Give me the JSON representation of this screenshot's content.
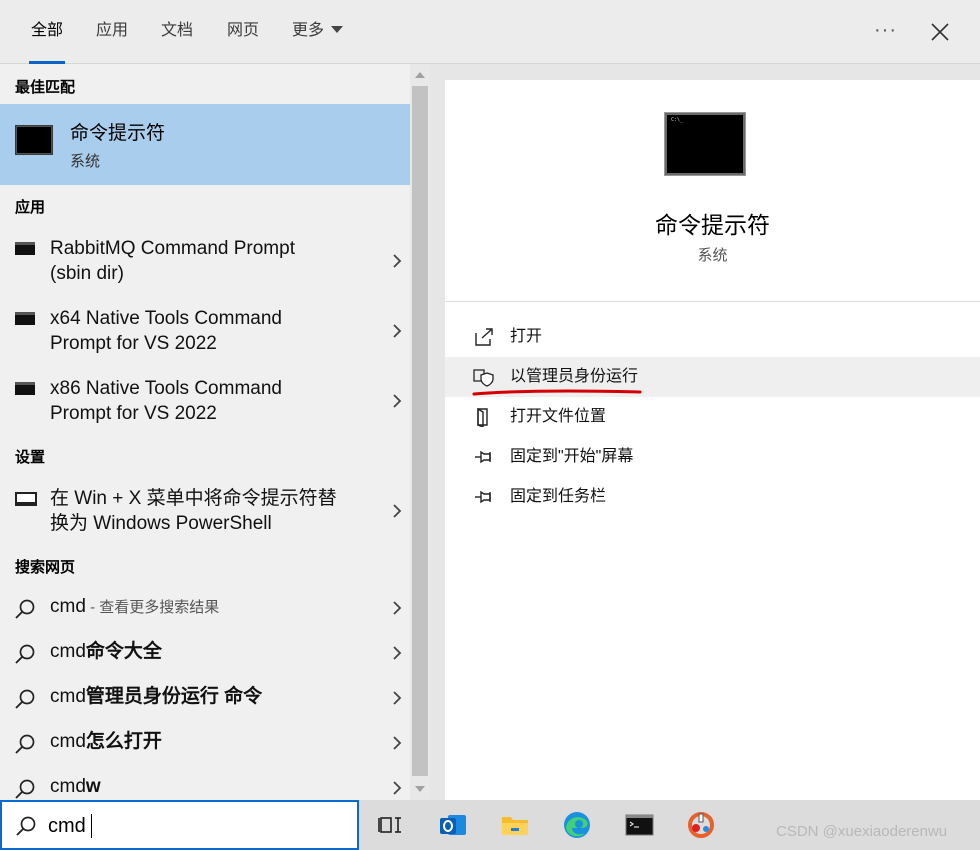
{
  "tabs": [
    {
      "label": "全部",
      "active": true
    },
    {
      "label": "应用",
      "active": false
    },
    {
      "label": "文档",
      "active": false
    },
    {
      "label": "网页",
      "active": false
    },
    {
      "label": "更多",
      "active": false
    }
  ],
  "window_controls": {
    "more_label": "···",
    "close_icon": "close-icon"
  },
  "sections": {
    "best_match": "最佳匹配",
    "apps": "应用",
    "settings": "设置",
    "web_search": "搜索网页"
  },
  "best_match": {
    "title": "命令提示符",
    "subtitle": "系统",
    "icon": "terminal-icon"
  },
  "apps": [
    {
      "line1": "RabbitMQ Command Prompt",
      "line2": "(sbin dir)"
    },
    {
      "line1": "x64 Native Tools Command",
      "line2": "Prompt for VS 2022"
    },
    {
      "line1": "x86 Native Tools Command",
      "line2": "Prompt for VS 2022"
    }
  ],
  "settings": [
    {
      "line1": "在 Win + X 菜单中将命令提示符替",
      "line2": "换为 Windows PowerShell"
    }
  ],
  "web_results": [
    {
      "prefix": "cmd",
      "bold": "",
      "hint": " - 查看更多搜索结果"
    },
    {
      "prefix": "cmd",
      "bold": "命令大全",
      "hint": ""
    },
    {
      "prefix": "cmd",
      "bold": "管理员身份运行 命令",
      "hint": ""
    },
    {
      "prefix": "cmd",
      "bold": "怎么打开",
      "hint": ""
    },
    {
      "prefix": "cmd",
      "bold": "w",
      "hint": ""
    }
  ],
  "preview": {
    "title": "命令提示符",
    "subtitle": "系统",
    "actions": [
      {
        "label": "打开",
        "icon": "open-icon"
      },
      {
        "label": "以管理员身份运行",
        "icon": "admin-shield-icon"
      },
      {
        "label": "打开文件位置",
        "icon": "file-location-icon"
      },
      {
        "label": "固定到\"开始\"屏幕",
        "icon": "pin-icon"
      },
      {
        "label": "固定到任务栏",
        "icon": "pin-icon"
      }
    ]
  },
  "search": {
    "value": "cmd",
    "placeholder": ""
  },
  "taskbar_icons": [
    "task-view-icon",
    "outlook-icon",
    "file-explorer-icon",
    "edge-icon",
    "terminal-icon",
    "app-icon"
  ],
  "watermark": "CSDN @xuexiaoderenwu",
  "colors": {
    "accent": "#0a64c8",
    "selected_bg": "#a9cdec",
    "annotation_red": "#d40000"
  }
}
